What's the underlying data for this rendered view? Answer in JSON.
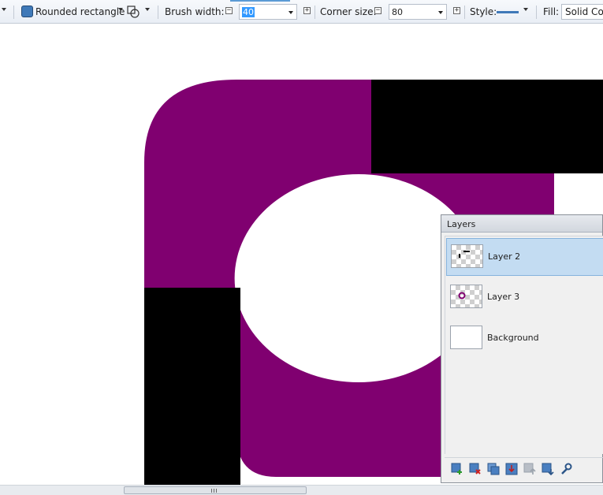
{
  "toolbar": {
    "shape_label": "Rounded rectangle",
    "brush_width_label": "Brush width:",
    "brush_width_value": "40",
    "corner_size_label": "Corner size:",
    "corner_size_value": "80",
    "style_label": "Style:",
    "fill_label": "Fill:",
    "fill_value": "Solid Col",
    "shape_color": "#3f79b8"
  },
  "canvas": {
    "background": "#ffffff",
    "ring_color": "#800070",
    "block_color": "#000000"
  },
  "layers_panel": {
    "title": "Layers",
    "layers": [
      {
        "name": "Layer 2",
        "selected": true,
        "thumbnail": "transparent-with-black-marks"
      },
      {
        "name": "Layer 3",
        "selected": false,
        "thumbnail": "transparent-with-purple-ring"
      },
      {
        "name": "Background",
        "selected": false,
        "thumbnail": "white"
      }
    ],
    "buttons": [
      "add-layer-icon",
      "delete-layer-icon",
      "duplicate-layer-icon",
      "merge-layer-down-icon",
      "move-layer-up-icon",
      "move-layer-down-icon",
      "layer-properties-icon"
    ]
  }
}
